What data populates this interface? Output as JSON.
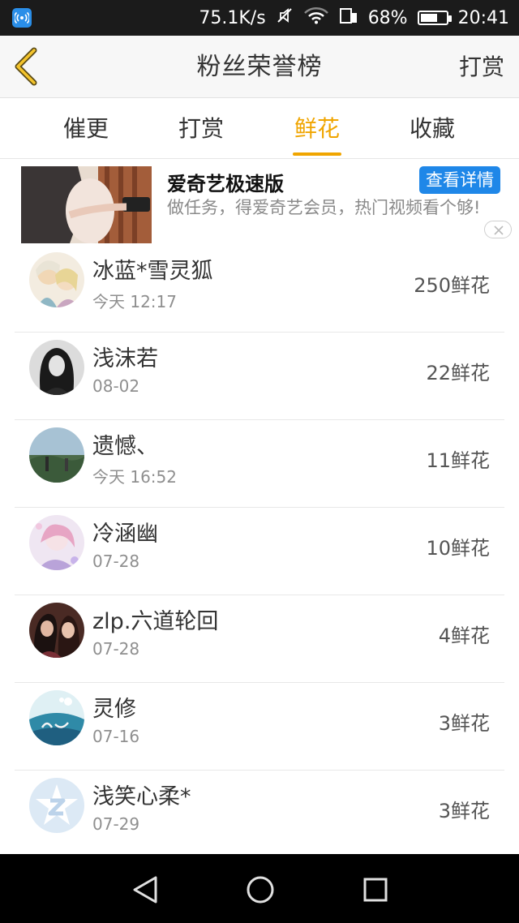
{
  "status_bar": {
    "speed": "75.1K/s",
    "battery_pct": "68%",
    "battery_level": 0.68,
    "time": "20:41"
  },
  "header": {
    "title": "粉丝荣誉榜",
    "right_action": "打赏"
  },
  "tabs": [
    {
      "label": "催更",
      "active": false
    },
    {
      "label": "打赏",
      "active": false
    },
    {
      "label": "鲜花",
      "active": true
    },
    {
      "label": "收藏",
      "active": false
    }
  ],
  "ad": {
    "title": "爱奇艺极速版",
    "description": "做任务，得爱奇艺会员，热门视频看个够!",
    "button": "查看详情"
  },
  "colors": {
    "accent": "#f0a500",
    "ad_button": "#1f87e8",
    "status_bar": "#1b1b1b"
  },
  "fans": [
    {
      "name": "冰蓝*雪灵狐",
      "date": "今天 12:17",
      "amount": "250鲜花",
      "avatar": "anime-couple-avatar"
    },
    {
      "name": "浅沫若",
      "date": "08-02",
      "amount": "22鲜花",
      "avatar": "bw-portrait-avatar"
    },
    {
      "name": "遗憾、",
      "date": "今天 16:52",
      "amount": "11鲜花",
      "avatar": "landscape-avatar"
    },
    {
      "name": "冷涵幽",
      "date": "07-28",
      "amount": "10鲜花",
      "avatar": "anime-girl-avatar"
    },
    {
      "name": "zlp.六道轮回",
      "date": "07-28",
      "amount": "4鲜花",
      "avatar": "two-girls-avatar"
    },
    {
      "name": "灵修",
      "date": "07-16",
      "amount": "3鲜花",
      "avatar": "calligraphy-avatar"
    },
    {
      "name": "浅笑心柔*",
      "date": "07-29",
      "amount": "3鲜花",
      "avatar": "qq-default-avatar"
    }
  ]
}
